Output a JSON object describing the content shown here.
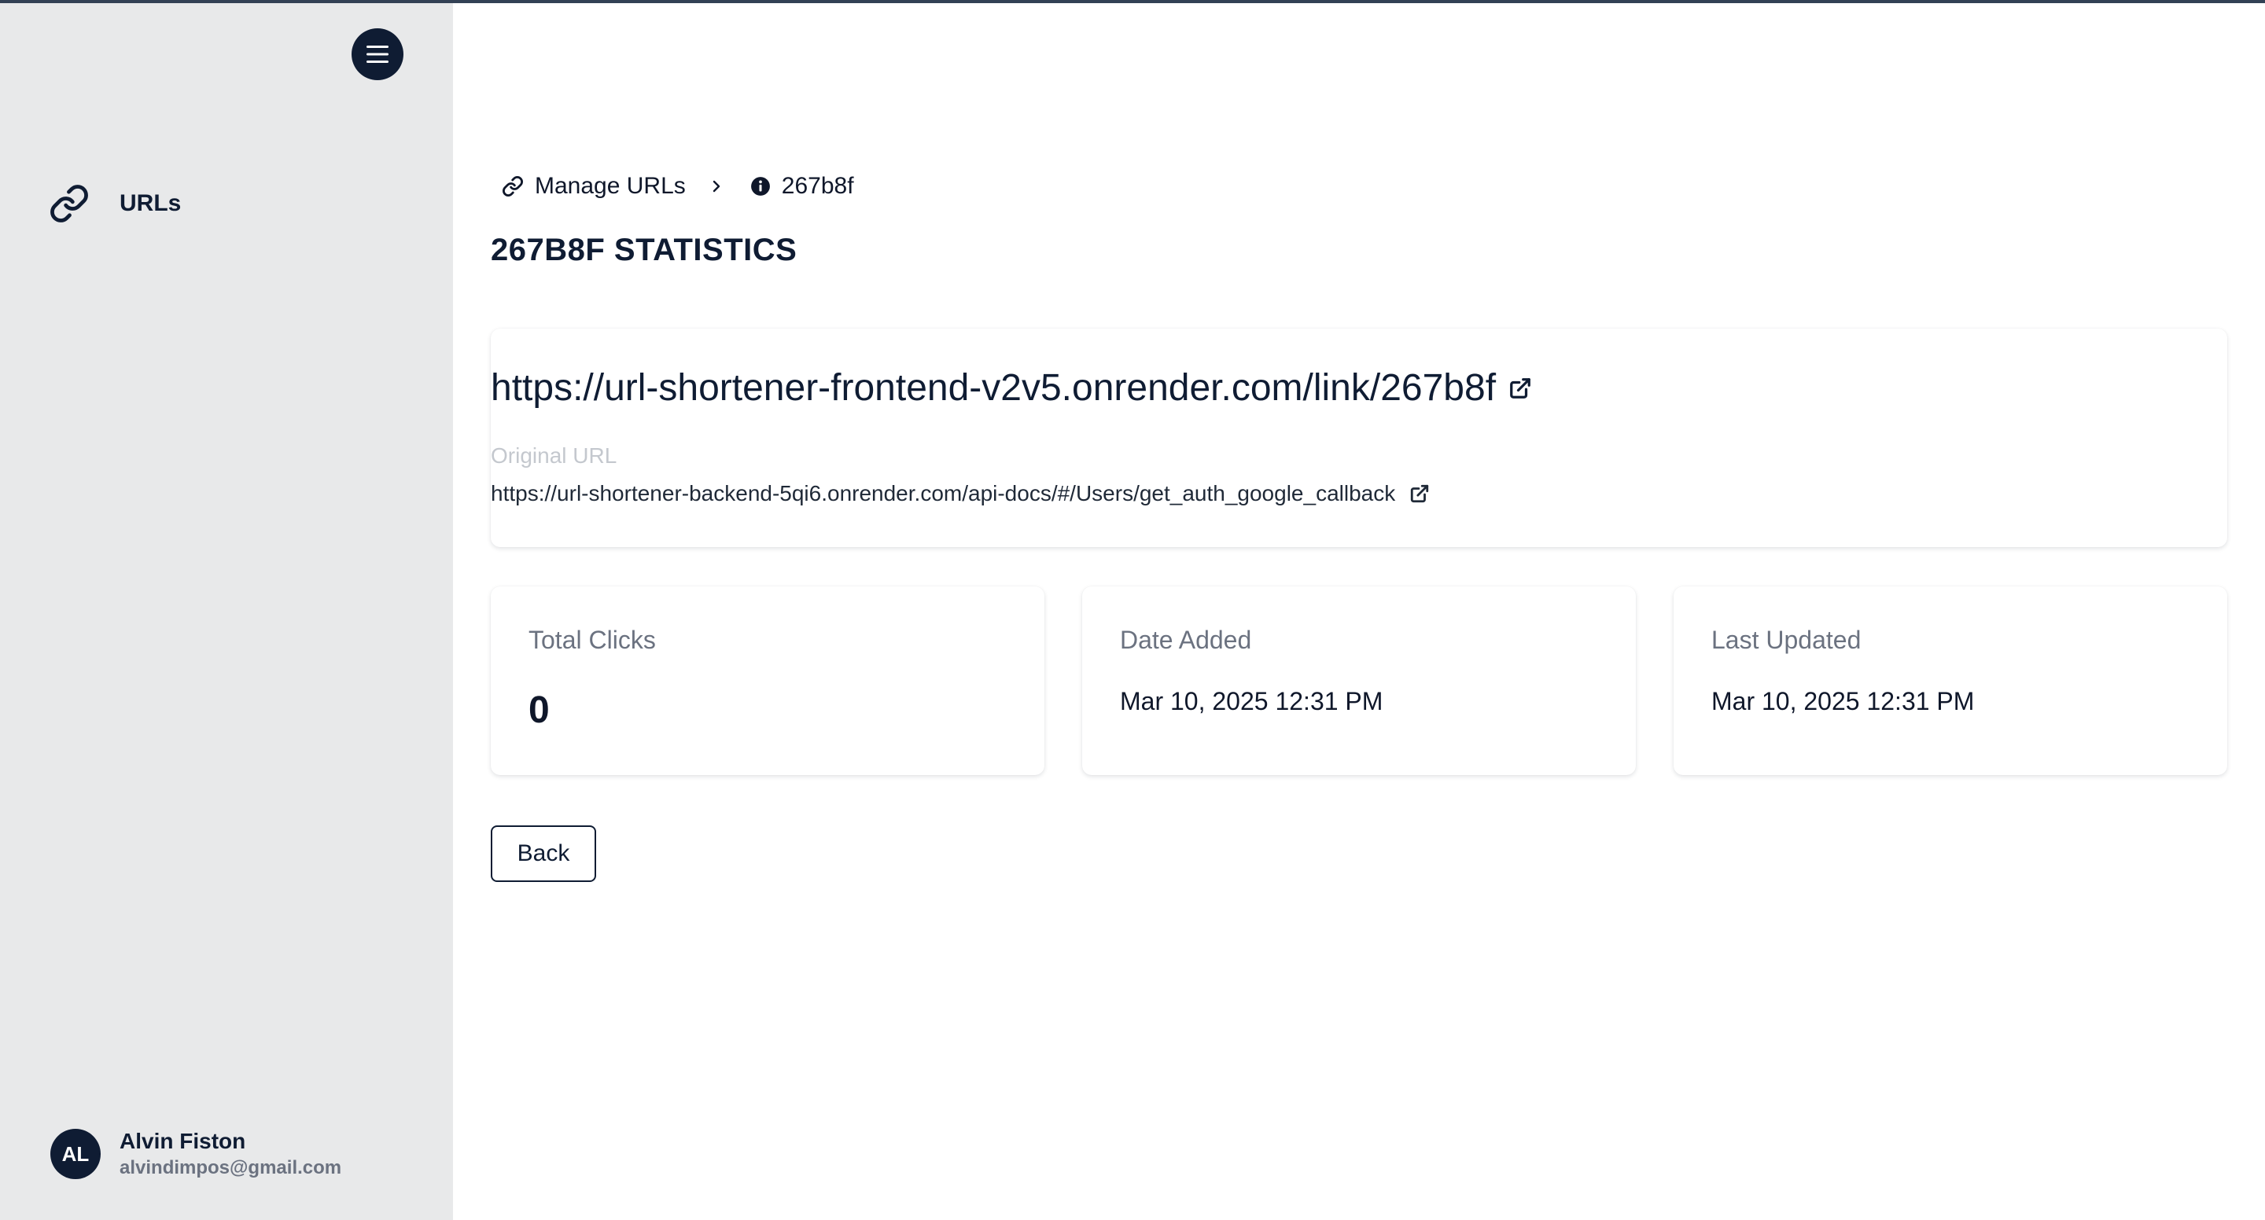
{
  "sidebar": {
    "menu_icon": "hamburger-menu-icon",
    "nav_items": [
      {
        "label": "URLs",
        "icon": "link-icon"
      }
    ],
    "user": {
      "initials": "AL",
      "name": "Alvin Fiston",
      "email": "alvindimpos@gmail.com"
    }
  },
  "breadcrumb": {
    "items": [
      {
        "label": "Manage URLs",
        "icon": "link-icon"
      },
      {
        "label": "267b8f",
        "icon": "info-icon"
      }
    ],
    "separator_icon": "chevron-right-icon"
  },
  "page": {
    "title": "267B8F STATISTICS"
  },
  "url_card": {
    "short_url": "https://url-shortener-frontend-v2v5.onrender.com/link/267b8f",
    "original_label": "Original URL",
    "original_url": "https://url-shortener-backend-5qi6.onrender.com/api-docs/#/Users/get_auth_google_callback",
    "external_icon": "external-link-icon"
  },
  "stats": [
    {
      "label": "Total Clicks",
      "value": "0"
    },
    {
      "label": "Date Added",
      "value": "Mar 10, 2025 12:31 PM"
    },
    {
      "label": "Last Updated",
      "value": "Mar 10, 2025 12:31 PM"
    }
  ],
  "actions": {
    "back_label": "Back"
  },
  "colors": {
    "sidebar_bg": "#e8e9ea",
    "primary_dark": "#0f1c33",
    "muted_text": "#6b7280",
    "label_faint": "#c4c8ce"
  }
}
